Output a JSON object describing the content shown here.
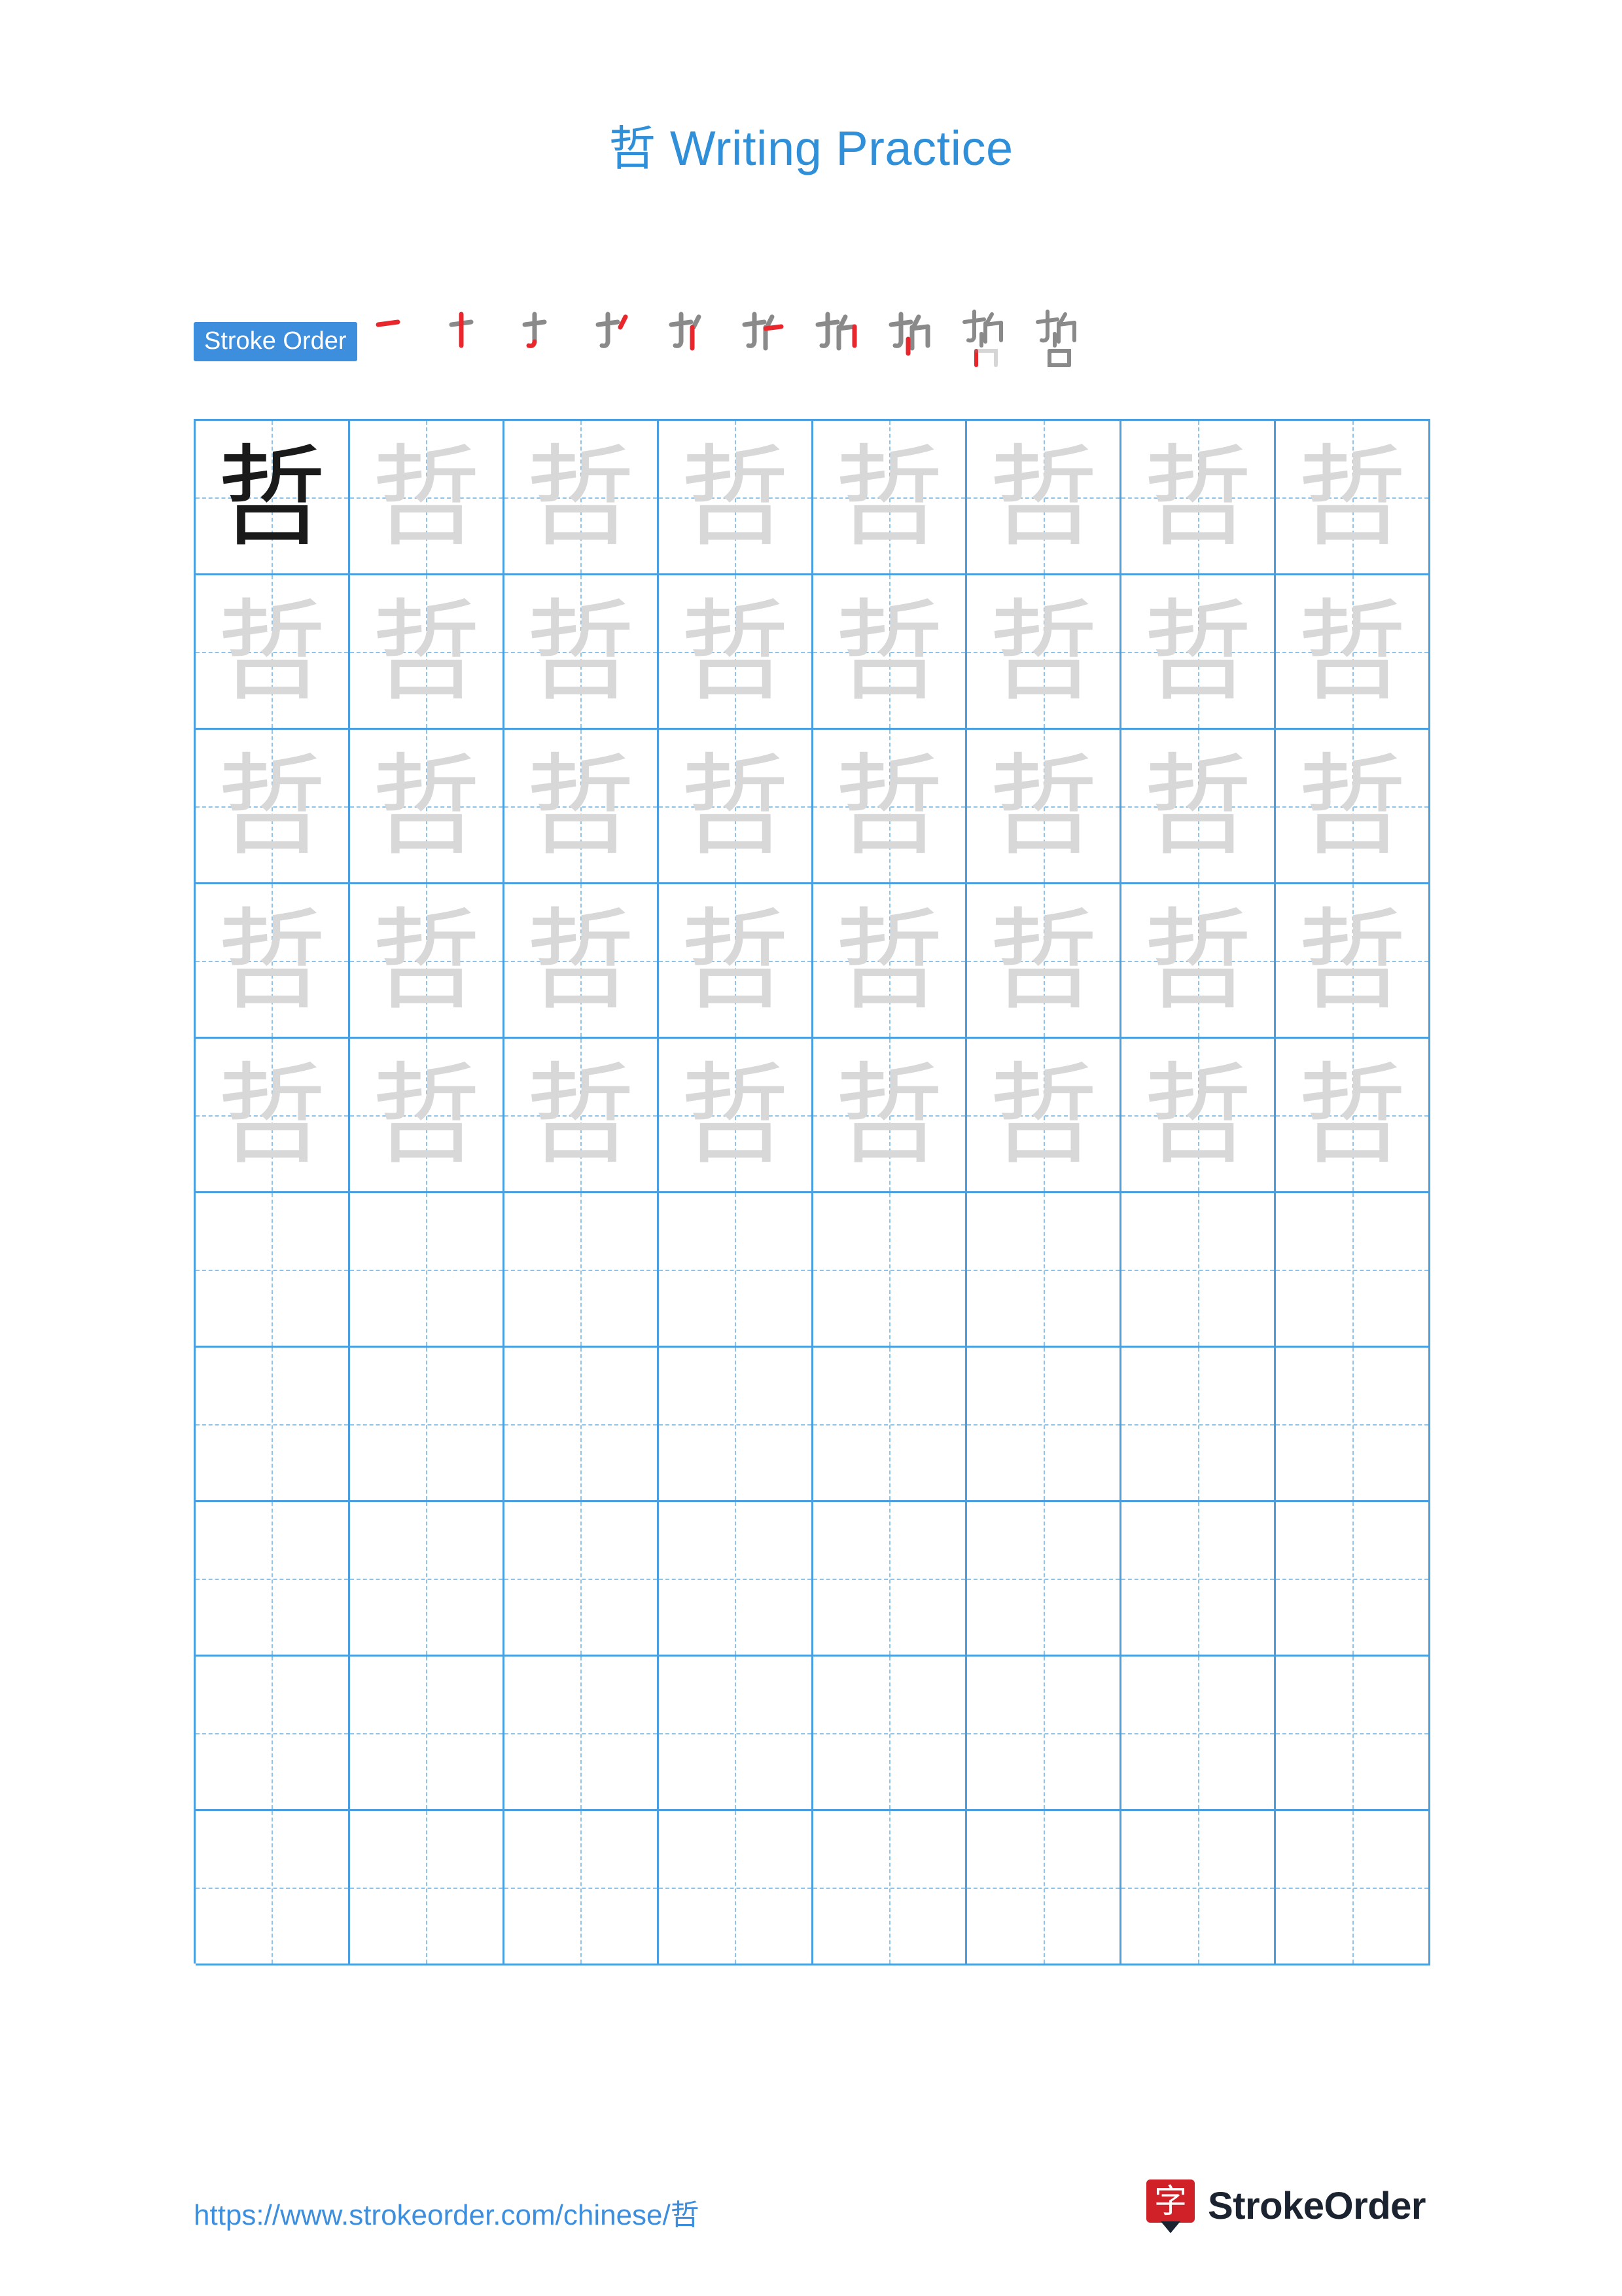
{
  "page": {
    "title_character": "哲",
    "title_text": " Writing Practice"
  },
  "stroke_order": {
    "label": "Stroke Order",
    "character": "哲",
    "total_strokes": 10,
    "steps": [
      {
        "index": 1,
        "partial": "一"
      },
      {
        "index": 2,
        "partial": "十"
      },
      {
        "index": 3,
        "partial": "扌"
      },
      {
        "index": 4,
        "partial": "扌"
      },
      {
        "index": 5,
        "partial": "扩"
      },
      {
        "index": 6,
        "partial": "折"
      },
      {
        "index": 7,
        "partial": "折"
      },
      {
        "index": 8,
        "partial": "折"
      },
      {
        "index": 9,
        "partial": "哲"
      },
      {
        "index": 10,
        "partial": "哲"
      }
    ]
  },
  "practice_grid": {
    "columns": 8,
    "rows": 10,
    "cells": [
      [
        "solid",
        "ghost",
        "ghost",
        "ghost",
        "ghost",
        "ghost",
        "ghost",
        "ghost"
      ],
      [
        "ghost",
        "ghost",
        "ghost",
        "ghost",
        "ghost",
        "ghost",
        "ghost",
        "ghost"
      ],
      [
        "ghost",
        "ghost",
        "ghost",
        "ghost",
        "ghost",
        "ghost",
        "ghost",
        "ghost"
      ],
      [
        "ghost",
        "ghost",
        "ghost",
        "ghost",
        "ghost",
        "ghost",
        "ghost",
        "ghost"
      ],
      [
        "ghost",
        "ghost",
        "ghost",
        "ghost",
        "ghost",
        "ghost",
        "ghost",
        "ghost"
      ],
      [
        "empty",
        "empty",
        "empty",
        "empty",
        "empty",
        "empty",
        "empty",
        "empty"
      ],
      [
        "empty",
        "empty",
        "empty",
        "empty",
        "empty",
        "empty",
        "empty",
        "empty"
      ],
      [
        "empty",
        "empty",
        "empty",
        "empty",
        "empty",
        "empty",
        "empty",
        "empty"
      ],
      [
        "empty",
        "empty",
        "empty",
        "empty",
        "empty",
        "empty",
        "empty",
        "empty"
      ],
      [
        "empty",
        "empty",
        "empty",
        "empty",
        "empty",
        "empty",
        "empty",
        "empty"
      ]
    ]
  },
  "footer": {
    "url": "https://www.strokeorder.com/chinese/哲",
    "brand_logo_character": "字",
    "brand_name": "StrokeOrder"
  },
  "colors": {
    "accent_blue": "#3e8ede",
    "grid_line": "#4a9fe0",
    "guide_line": "#8fc4ea",
    "ghost_char": "#d8d8d8",
    "solid_char": "#1a1a1a",
    "new_stroke_red": "#e8262c",
    "logo_red": "#cf2127"
  }
}
